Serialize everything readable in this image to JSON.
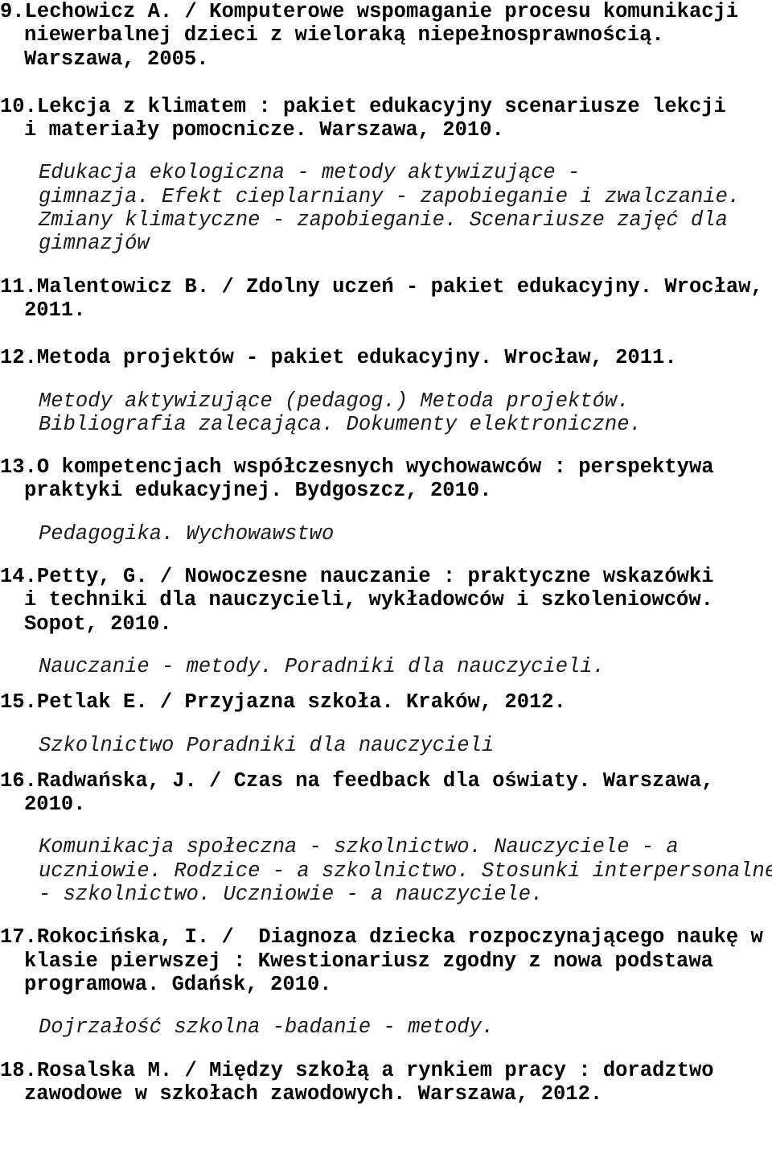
{
  "document": {
    "kind": "bibliography-list",
    "language": "pl",
    "page_background": "#ffffff",
    "text_color": "#000000"
  },
  "entries": [
    {
      "number": "9.",
      "lines": [
        "9.Lechowicz A. / Komputerowe wspomaganie procesu komunikacji",
        "niewerbalnej dzieci z wieloraką niepełnosprawnością.",
        "Warszawa, 2005."
      ],
      "subjects": []
    },
    {
      "number": "10.",
      "lines": [
        "10.Lekcja z klimatem : pakiet edukacyjny scenariusze lekcji",
        "i materiały pomocnicze. Warszawa, 2010."
      ],
      "subjects": [
        "Edukacja ekologiczna - metody aktywizujące -",
        "gimnazja. Efekt cieplarniany - zapobieganie i zwalczanie.",
        "Zmiany klimatyczne - zapobieganie. Scenariusze zajęć dla",
        "gimnazjów"
      ]
    },
    {
      "number": "11.",
      "lines": [
        "11.Malentowicz B. / Zdolny uczeń - pakiet edukacyjny. Wrocław,",
        "2011."
      ],
      "subjects": []
    },
    {
      "number": "12.",
      "lines": [
        "12.Metoda projektów - pakiet edukacyjny. Wrocław, 2011."
      ],
      "subjects": [
        "Metody aktywizujące (pedagog.) Metoda projektów.",
        "Bibliografia zalecająca. Dokumenty elektroniczne."
      ]
    },
    {
      "number": "13.",
      "lines": [
        "13.O kompetencjach współczesnych wychowawców : perspektywa",
        "praktyki edukacyjnej. Bydgoszcz, 2010."
      ],
      "subjects": [
        "Pedagogika. Wychowawstwo"
      ]
    },
    {
      "number": "14.",
      "lines": [
        "14.Petty, G. / Nowoczesne nauczanie : praktyczne wskazówki",
        "i techniki dla nauczycieli, wykładowców i szkoleniowców.",
        "Sopot, 2010."
      ],
      "subjects": [
        "Nauczanie - metody. Poradniki dla nauczycieli."
      ]
    },
    {
      "number": "15.",
      "lines": [
        "15.Petlak E. / Przyjazna szkoła. Kraków, 2012."
      ],
      "subjects": [
        "Szkolnictwo Poradniki dla nauczycieli"
      ]
    },
    {
      "number": "16.",
      "lines": [
        "16.Radwańska, J. / Czas na feedback dla oświaty. Warszawa,",
        "2010."
      ],
      "subjects": [
        "Komunikacja społeczna - szkolnictwo. Nauczyciele - a",
        "uczniowie. Rodzice - a szkolnictwo. Stosunki interpersonalne",
        "- szkolnictwo. Uczniowie - a nauczyciele."
      ]
    },
    {
      "number": "17.",
      "lines": [
        "17.Rokocińska, I. /  Diagnoza dziecka rozpoczynającego naukę w",
        "klasie pierwszej : Kwestionariusz zgodny z nowa podstawa",
        "programowa. Gdańsk, 2010."
      ],
      "subjects": [
        "Dojrzałość szkolna -badanie - metody."
      ]
    },
    {
      "number": "18.",
      "lines": [
        "18.Rosalska M. / Między szkołą a rynkiem pracy : doradztwo",
        "zawodowe w szkołach zawodowych. Warszawa, 2012."
      ],
      "subjects": []
    }
  ]
}
